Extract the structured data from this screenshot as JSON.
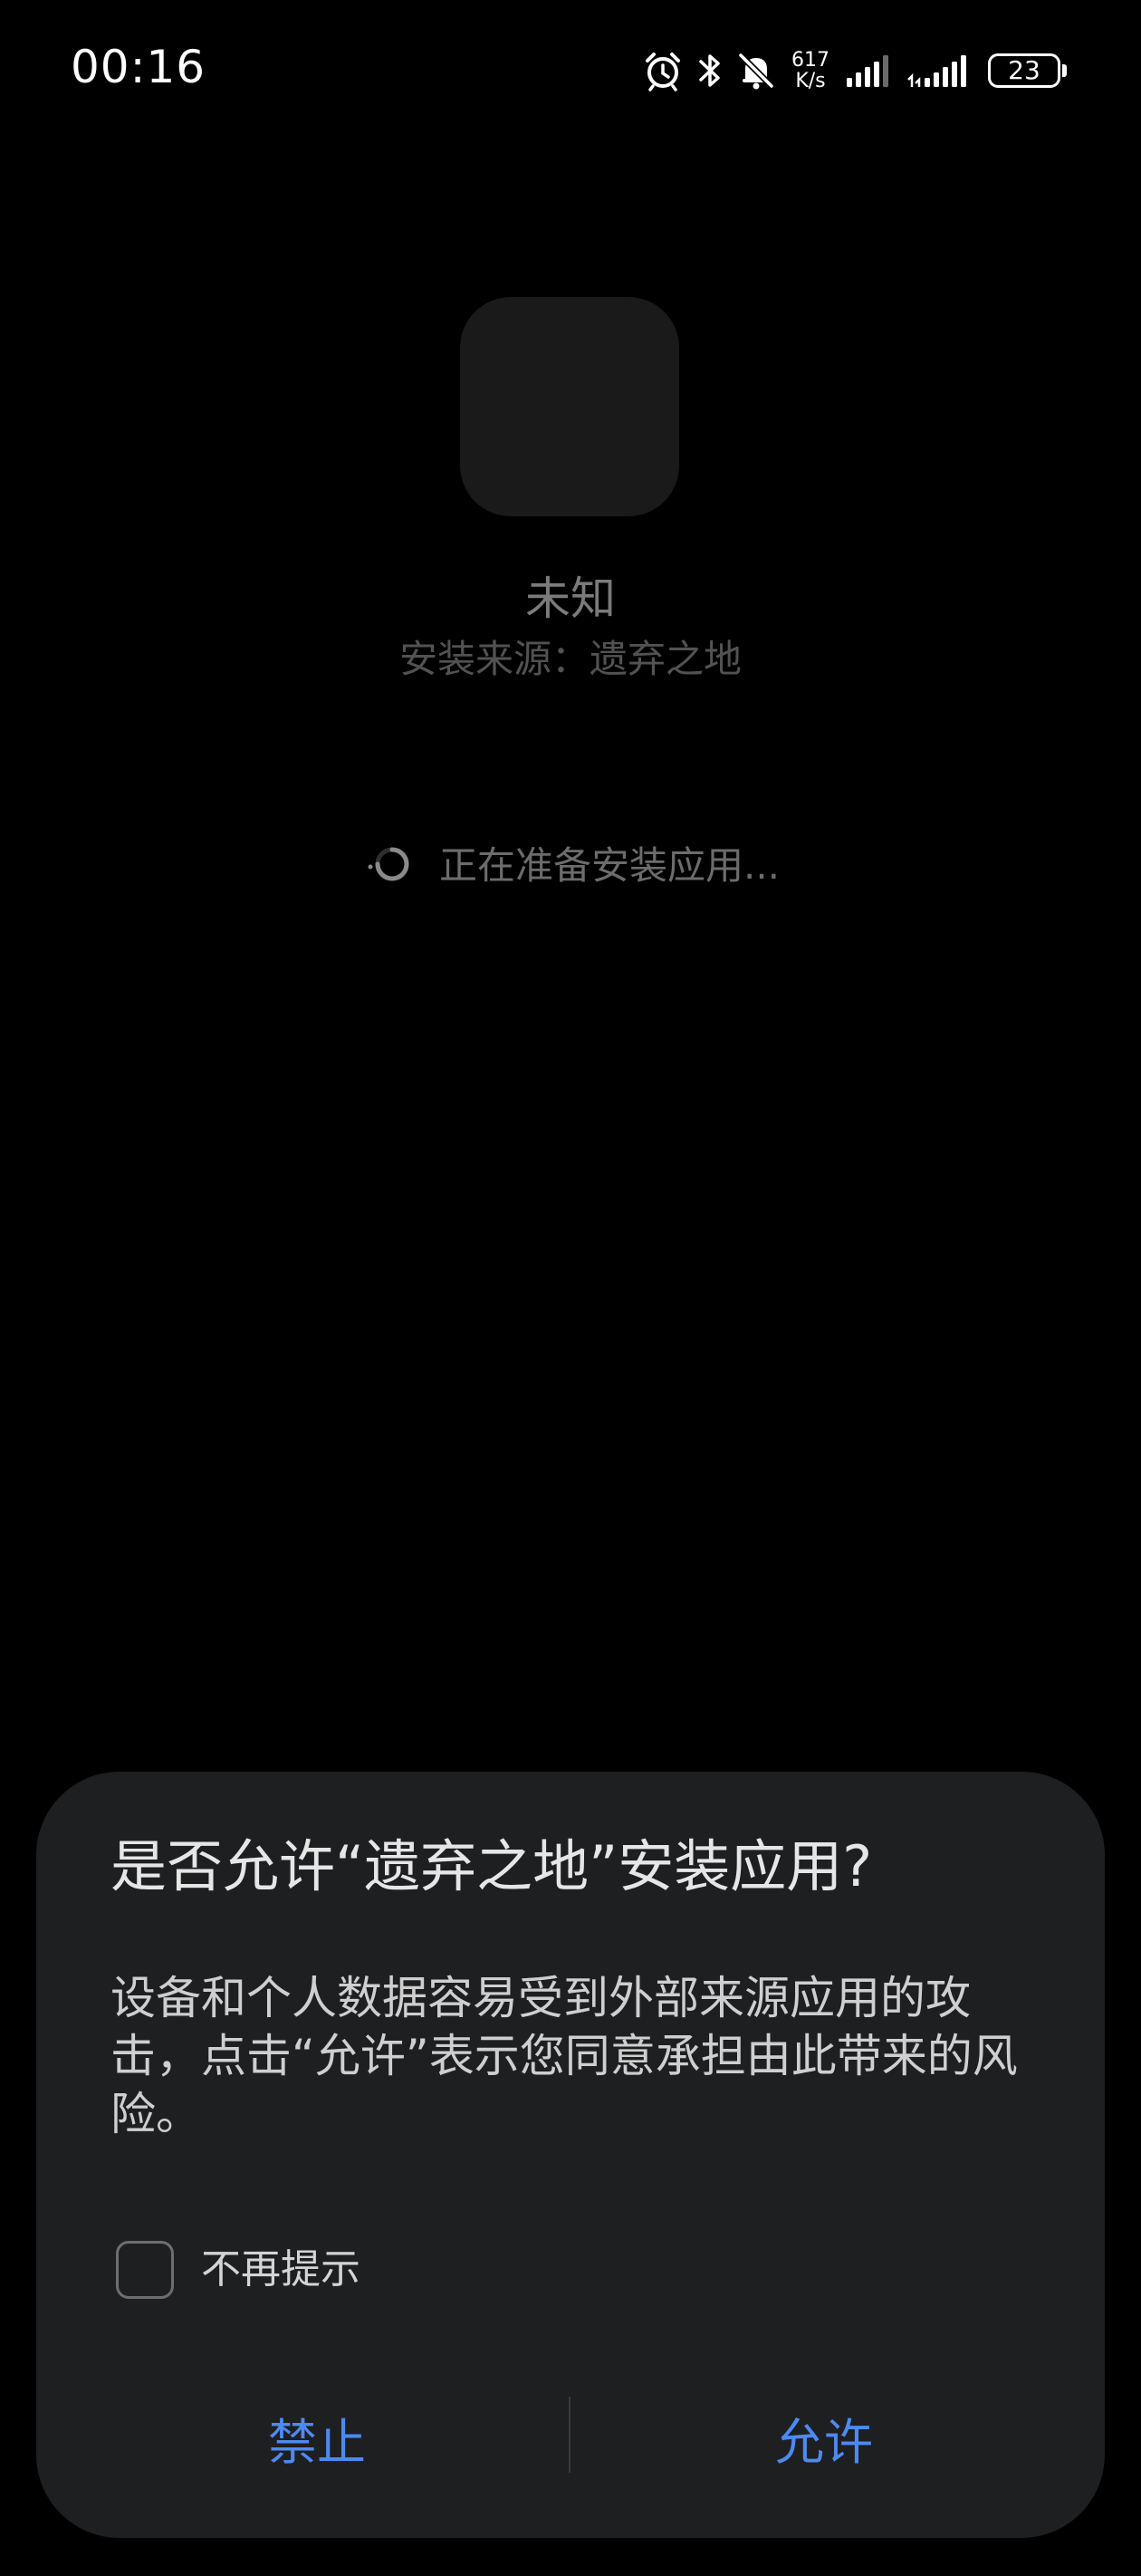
{
  "status_bar": {
    "time": "00:16",
    "net_speed_value": "617",
    "net_speed_unit": "K/s",
    "battery_level": "23",
    "icons": [
      "alarm-icon",
      "bluetooth-icon",
      "mute-bell-icon",
      "signal-icon",
      "signal-icon"
    ]
  },
  "app": {
    "name": "未知",
    "source": "安装来源：遗弃之地",
    "status": "正在准备安装应用..."
  },
  "dialog": {
    "title": "是否允许“遗弃之地”安装应用?",
    "message": "设备和个人数据容易受到外部来源应用的攻击，点击“允许”表示您同意承担由此带来的风险。",
    "checkbox_label": "不再提示",
    "checkbox_checked": false,
    "deny_label": "禁止",
    "allow_label": "允许"
  },
  "colors": {
    "background": "#000000",
    "dialog_background": "#1e1f21",
    "accent": "#4d8af0"
  }
}
